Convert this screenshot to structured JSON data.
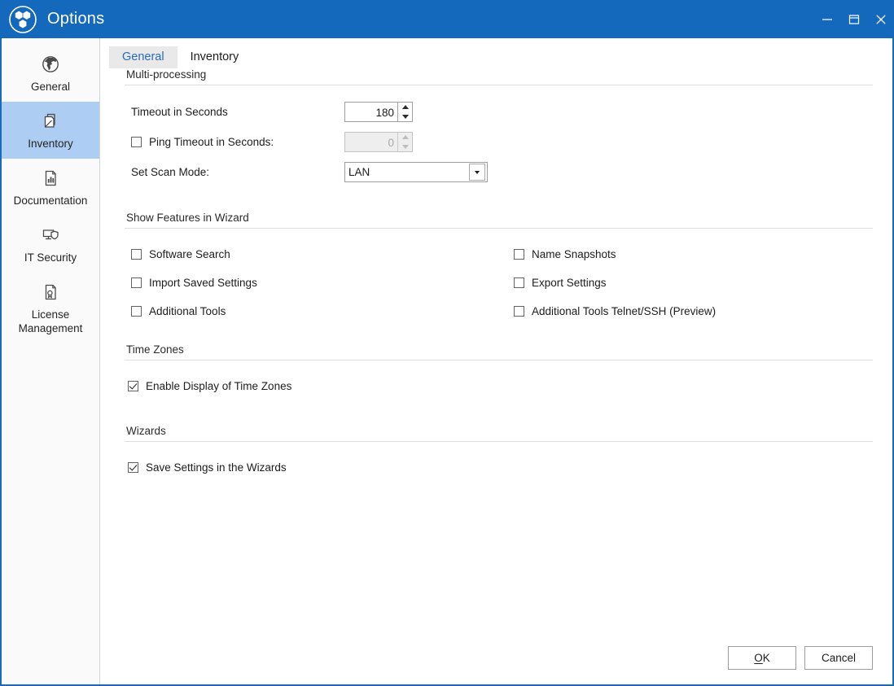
{
  "window": {
    "title": "Options",
    "logo_icon": "three-hexagon-circle-logo",
    "accent_color": "#1569bd",
    "border_color": "#1a6ab8",
    "controls": {
      "minimize": "minimize-icon",
      "restore": "restore-icon",
      "close": "close-icon"
    }
  },
  "sidebar": {
    "items": [
      {
        "label": "General",
        "icon": "globe-icon",
        "active": false
      },
      {
        "label": "Inventory",
        "icon": "documents-stack-icon",
        "active": true
      },
      {
        "label": "Documentation",
        "icon": "document-chart-icon",
        "active": false
      },
      {
        "label": "IT Security",
        "icon": "monitor-shield-icon",
        "active": false
      },
      {
        "label": "License Management",
        "icon": "document-seal-icon",
        "active": false
      }
    ],
    "active_highlight_color": "#aecdf2"
  },
  "tabs": [
    {
      "label": "General",
      "active": true
    },
    {
      "label": "Inventory",
      "active": false
    }
  ],
  "sections": {
    "multi_processing": {
      "title": "Multi-processing",
      "timeout": {
        "label": "Timeout in Seconds",
        "value": "180",
        "enabled": true
      },
      "ping_timeout": {
        "label": "Ping Timeout in Seconds:",
        "checked": false,
        "value": "0",
        "enabled": false
      },
      "scan_mode": {
        "label": "Set Scan Mode:",
        "value": "LAN",
        "options": [
          "LAN"
        ]
      }
    },
    "show_features": {
      "title": "Show Features in Wizard",
      "left_column": [
        {
          "label": "Software Search",
          "checked": false
        },
        {
          "label": "Import Saved Settings",
          "checked": false
        },
        {
          "label": "Additional Tools",
          "checked": false
        }
      ],
      "right_column": [
        {
          "label": "Name Snapshots",
          "checked": false
        },
        {
          "label": "Export Settings",
          "checked": false
        },
        {
          "label": "Additional Tools Telnet/SSH (Preview)",
          "checked": false
        }
      ]
    },
    "time_zones": {
      "title": "Time Zones",
      "items": [
        {
          "label": "Enable Display of Time Zones",
          "checked": true
        }
      ]
    },
    "wizards": {
      "title": "Wizards",
      "items": [
        {
          "label": "Save Settings in the Wizards",
          "checked": true
        }
      ]
    }
  },
  "footer": {
    "ok_accel": "O",
    "ok_rest": "K",
    "cancel_label": "Cancel"
  }
}
